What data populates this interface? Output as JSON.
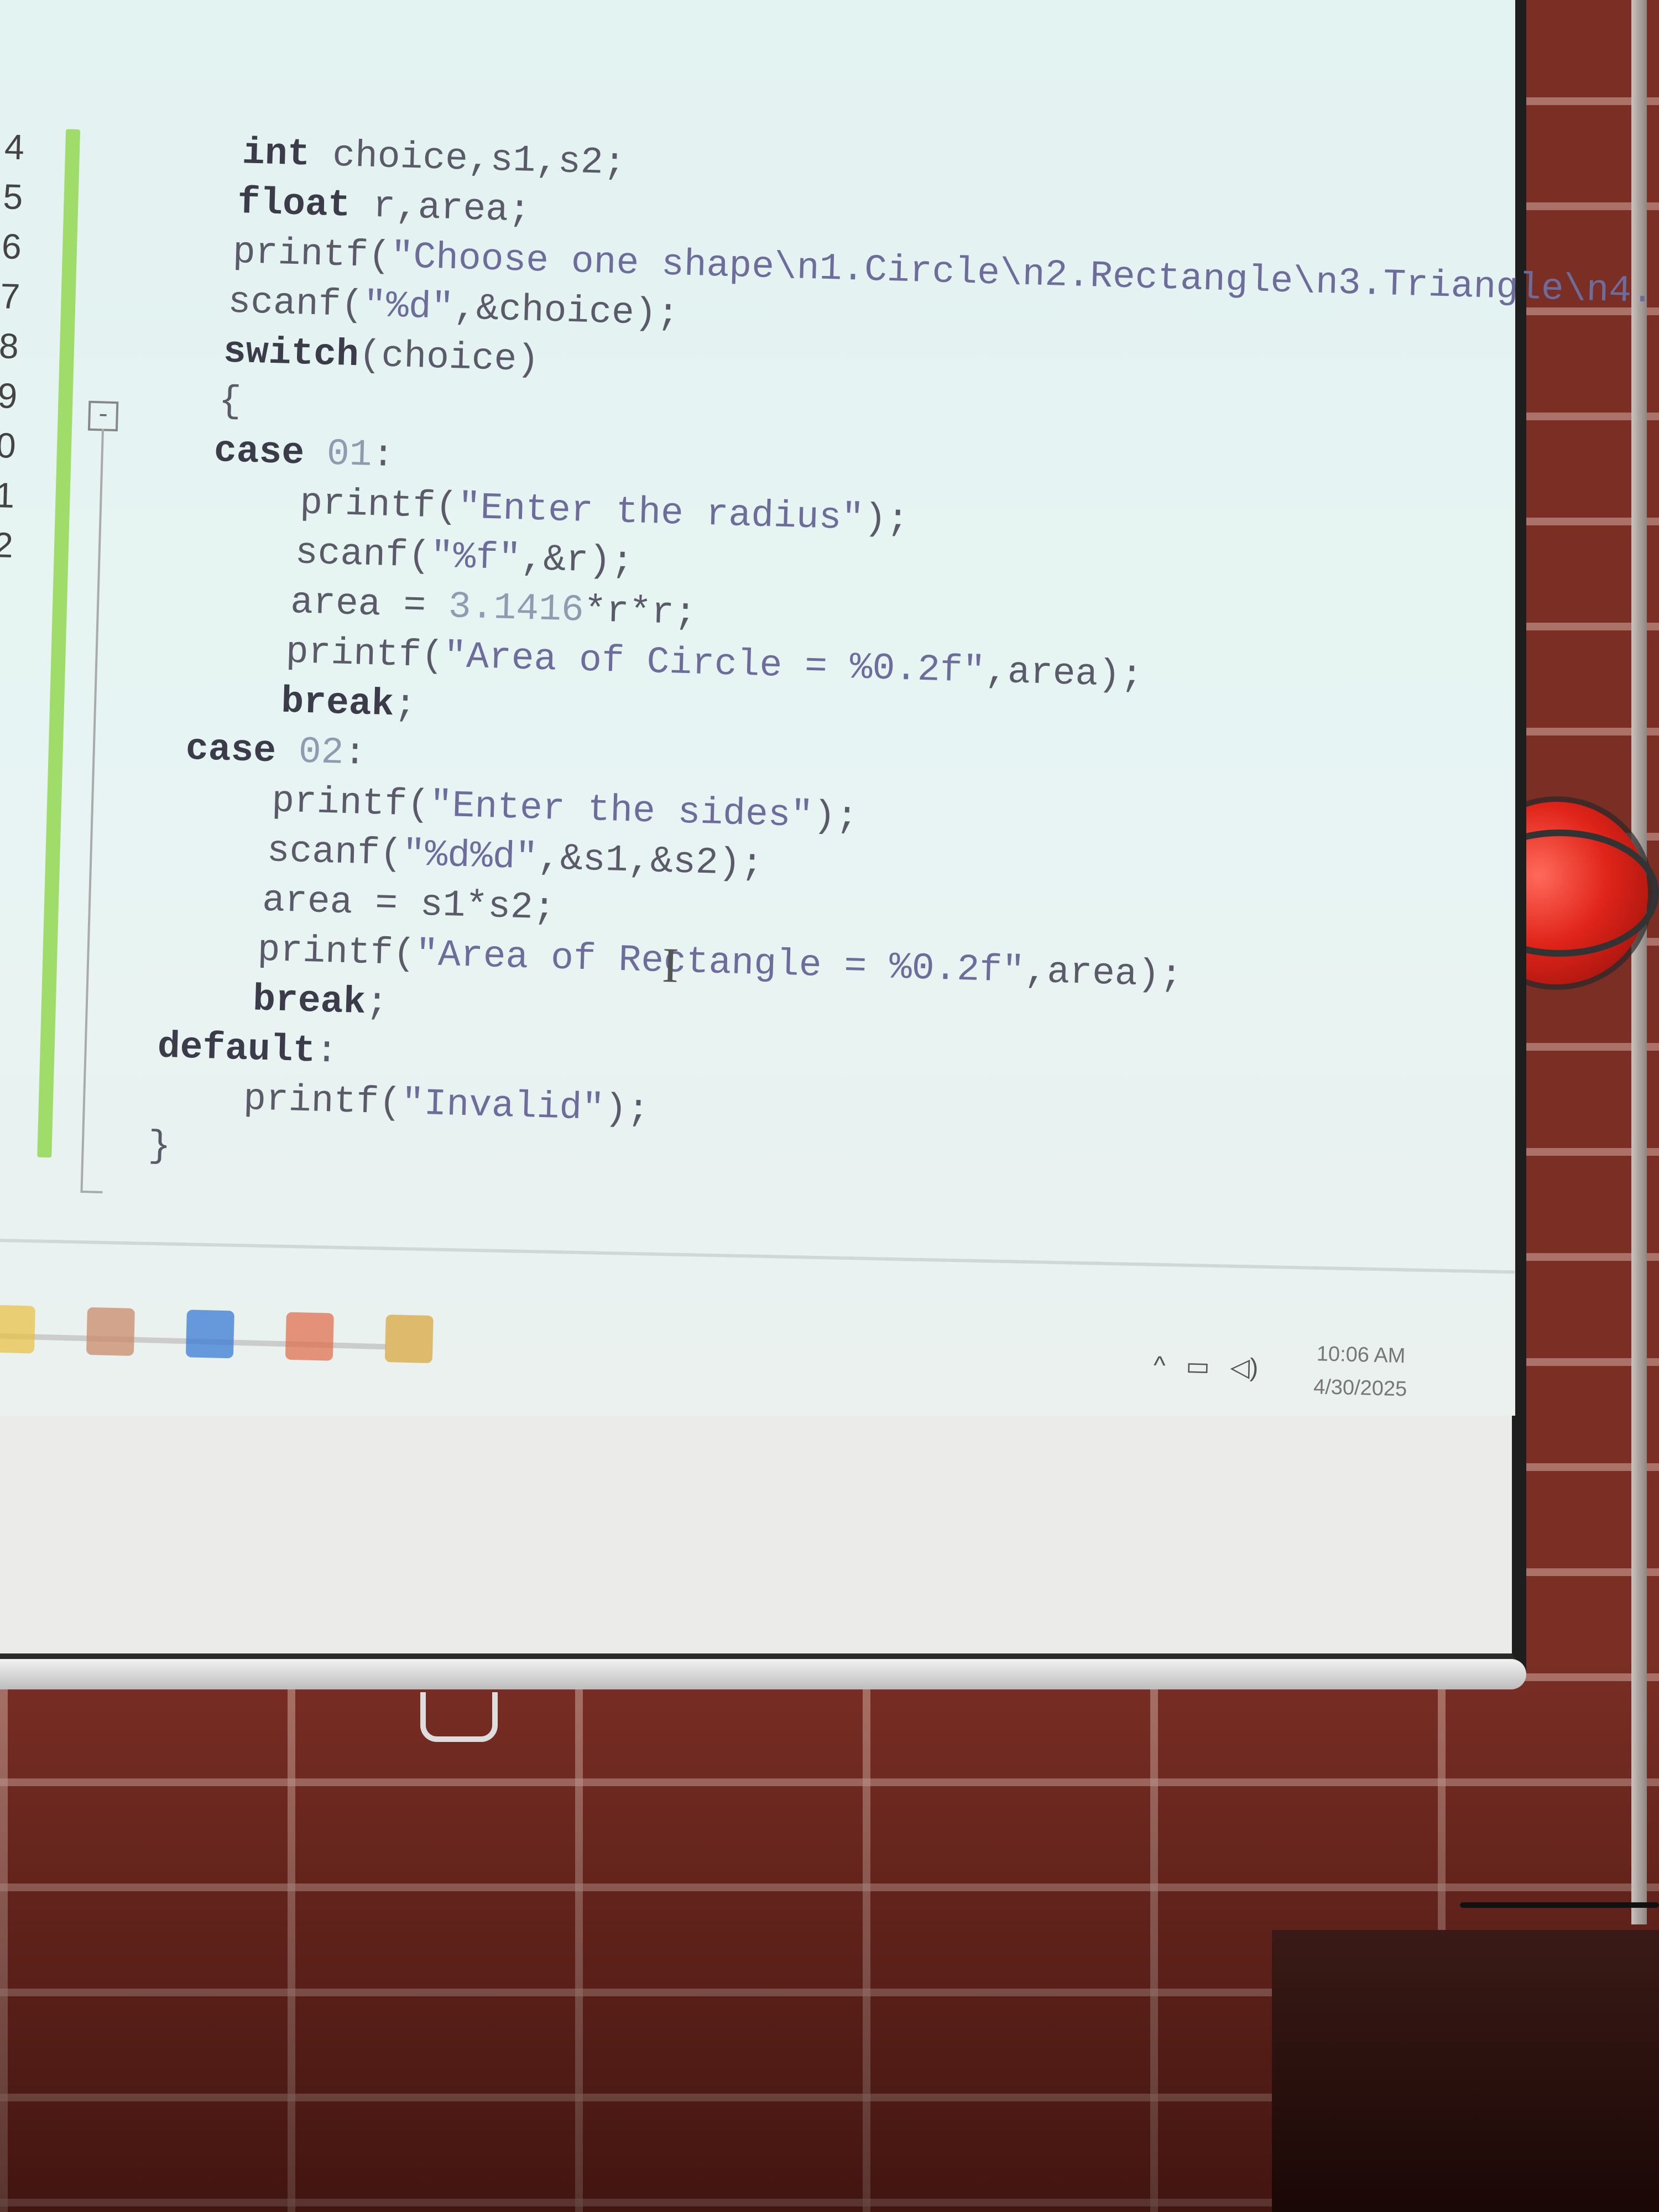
{
  "editor": {
    "line_numbers": [
      "4",
      "5",
      "6",
      "7",
      "8",
      "9",
      "0",
      "1",
      "2"
    ],
    "fold_marker": "-",
    "code_lines": [
      {
        "indent": 4,
        "tokens": [
          {
            "t": "kw",
            "v": "int"
          },
          {
            "t": "txt",
            "v": " choice,s1,s2;"
          }
        ]
      },
      {
        "indent": 4,
        "tokens": [
          {
            "t": "kw",
            "v": "float"
          },
          {
            "t": "txt",
            "v": " r,area;"
          }
        ]
      },
      {
        "indent": 4,
        "tokens": [
          {
            "t": "txt",
            "v": "printf("
          },
          {
            "t": "str",
            "v": "\"Choose one shape\\n1.Circle\\n2.Rectangle\\n3.Triangle\\n4."
          }
        ]
      },
      {
        "indent": 4,
        "tokens": [
          {
            "t": "txt",
            "v": "scanf("
          },
          {
            "t": "str",
            "v": "\"%d\""
          },
          {
            "t": "txt",
            "v": ",&choice);"
          }
        ]
      },
      {
        "indent": 4,
        "tokens": [
          {
            "t": "kw",
            "v": "switch"
          },
          {
            "t": "txt",
            "v": "(choice)"
          }
        ]
      },
      {
        "indent": 4,
        "tokens": [
          {
            "t": "txt",
            "v": "{"
          }
        ]
      },
      {
        "indent": 4,
        "tokens": [
          {
            "t": "kw",
            "v": "case"
          },
          {
            "t": "num",
            "v": " 01"
          },
          {
            "t": "txt",
            "v": ":"
          }
        ]
      },
      {
        "indent": 8,
        "tokens": [
          {
            "t": "txt",
            "v": "printf("
          },
          {
            "t": "str",
            "v": "\"Enter the radius\""
          },
          {
            "t": "txt",
            "v": ");"
          }
        ]
      },
      {
        "indent": 8,
        "tokens": [
          {
            "t": "txt",
            "v": "scanf("
          },
          {
            "t": "str",
            "v": "\"%f\""
          },
          {
            "t": "txt",
            "v": ",&r);"
          }
        ]
      },
      {
        "indent": 8,
        "tokens": [
          {
            "t": "txt",
            "v": "area = "
          },
          {
            "t": "num",
            "v": "3.1416"
          },
          {
            "t": "txt",
            "v": "*r*r;"
          }
        ]
      },
      {
        "indent": 8,
        "tokens": [
          {
            "t": "txt",
            "v": "printf("
          },
          {
            "t": "str",
            "v": "\"Area of Circle = %0.2f\""
          },
          {
            "t": "txt",
            "v": ",area);"
          }
        ]
      },
      {
        "indent": 8,
        "tokens": [
          {
            "t": "kw",
            "v": "break"
          },
          {
            "t": "txt",
            "v": ";"
          }
        ]
      },
      {
        "indent": 4,
        "tokens": [
          {
            "t": "kw",
            "v": "case"
          },
          {
            "t": "num",
            "v": " 02"
          },
          {
            "t": "txt",
            "v": ":"
          }
        ]
      },
      {
        "indent": 8,
        "tokens": [
          {
            "t": "txt",
            "v": "printf("
          },
          {
            "t": "str",
            "v": "\"Enter the sides\""
          },
          {
            "t": "txt",
            "v": ");"
          }
        ]
      },
      {
        "indent": 8,
        "tokens": [
          {
            "t": "txt",
            "v": "scanf("
          },
          {
            "t": "str",
            "v": "\"%d%d\""
          },
          {
            "t": "txt",
            "v": ",&s1,&s2);"
          }
        ]
      },
      {
        "indent": 8,
        "tokens": [
          {
            "t": "txt",
            "v": "area = s1*s2;"
          }
        ]
      },
      {
        "indent": 8,
        "tokens": [
          {
            "t": "txt",
            "v": "printf("
          },
          {
            "t": "str",
            "v": "\"Area of Rectangle = %0.2f\""
          },
          {
            "t": "txt",
            "v": ",area);"
          }
        ]
      },
      {
        "indent": 8,
        "tokens": [
          {
            "t": "kw",
            "v": "break"
          },
          {
            "t": "txt",
            "v": ";"
          }
        ]
      },
      {
        "indent": 4,
        "tokens": [
          {
            "t": "kw",
            "v": "default"
          },
          {
            "t": "txt",
            "v": ":"
          }
        ]
      },
      {
        "indent": 8,
        "tokens": [
          {
            "t": "txt",
            "v": "printf("
          },
          {
            "t": "str",
            "v": "\"Invalid\""
          },
          {
            "t": "txt",
            "v": ");"
          }
        ]
      },
      {
        "indent": 4,
        "tokens": [
          {
            "t": "txt",
            "v": "}"
          }
        ]
      }
    ]
  },
  "taskbar": {
    "icons": [
      {
        "name": "file-explorer-icon",
        "color": "#e8c24a"
      },
      {
        "name": "photos-icon",
        "color": "#c98a6a"
      },
      {
        "name": "edge-browser-icon",
        "color": "#3a7bd5"
      },
      {
        "name": "code-blocks-icon",
        "color": "#e07050"
      },
      {
        "name": "app-tiles-icon",
        "color": "#d9a840"
      }
    ],
    "tray": {
      "chevron": "^",
      "network_glyph": "▭",
      "volume_glyph": "◁)"
    },
    "clock": {
      "time": "10:06 AM",
      "date": "4/30/2025"
    }
  },
  "colors": {
    "keyword": "#3b3b4a",
    "string": "#6d6c9a",
    "number": "#8f9bb0",
    "change_bar": "#9fdc6a"
  }
}
